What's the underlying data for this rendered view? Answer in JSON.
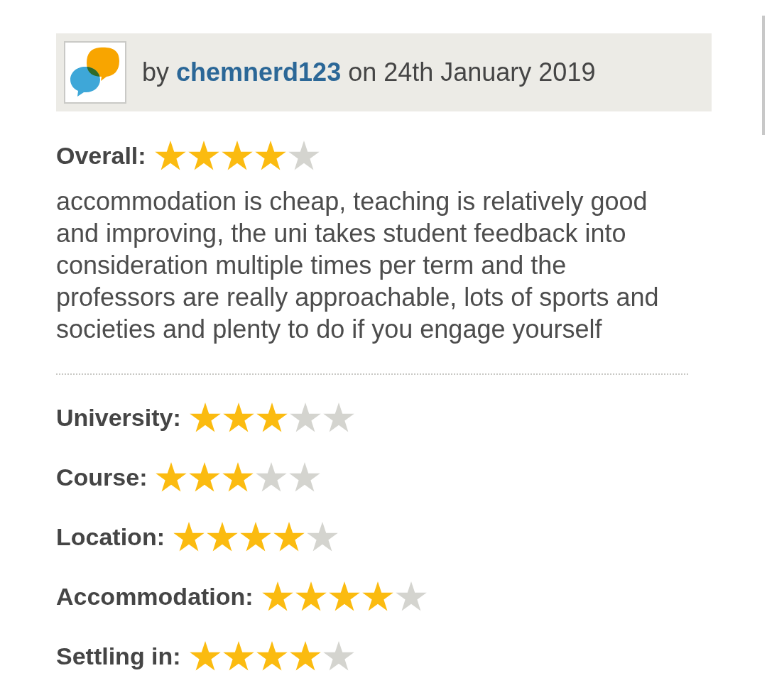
{
  "byline": {
    "prefix": "by",
    "author": "chemnerd123",
    "date_text": "on 24th January 2019"
  },
  "overall": {
    "label": "Overall:",
    "stars": 4
  },
  "review_text": "accommodation is cheap, teaching is relatively good and improving, the uni takes student feedback into consideration multiple times per term and the professors are really approachable, lots of sports and societies and plenty to do if you engage yourself",
  "ratings": [
    {
      "label": "University:",
      "stars": 3
    },
    {
      "label": "Course:",
      "stars": 3
    },
    {
      "label": "Location:",
      "stars": 4
    },
    {
      "label": "Accommodation:",
      "stars": 4
    },
    {
      "label": "Settling in:",
      "stars": 4
    }
  ]
}
